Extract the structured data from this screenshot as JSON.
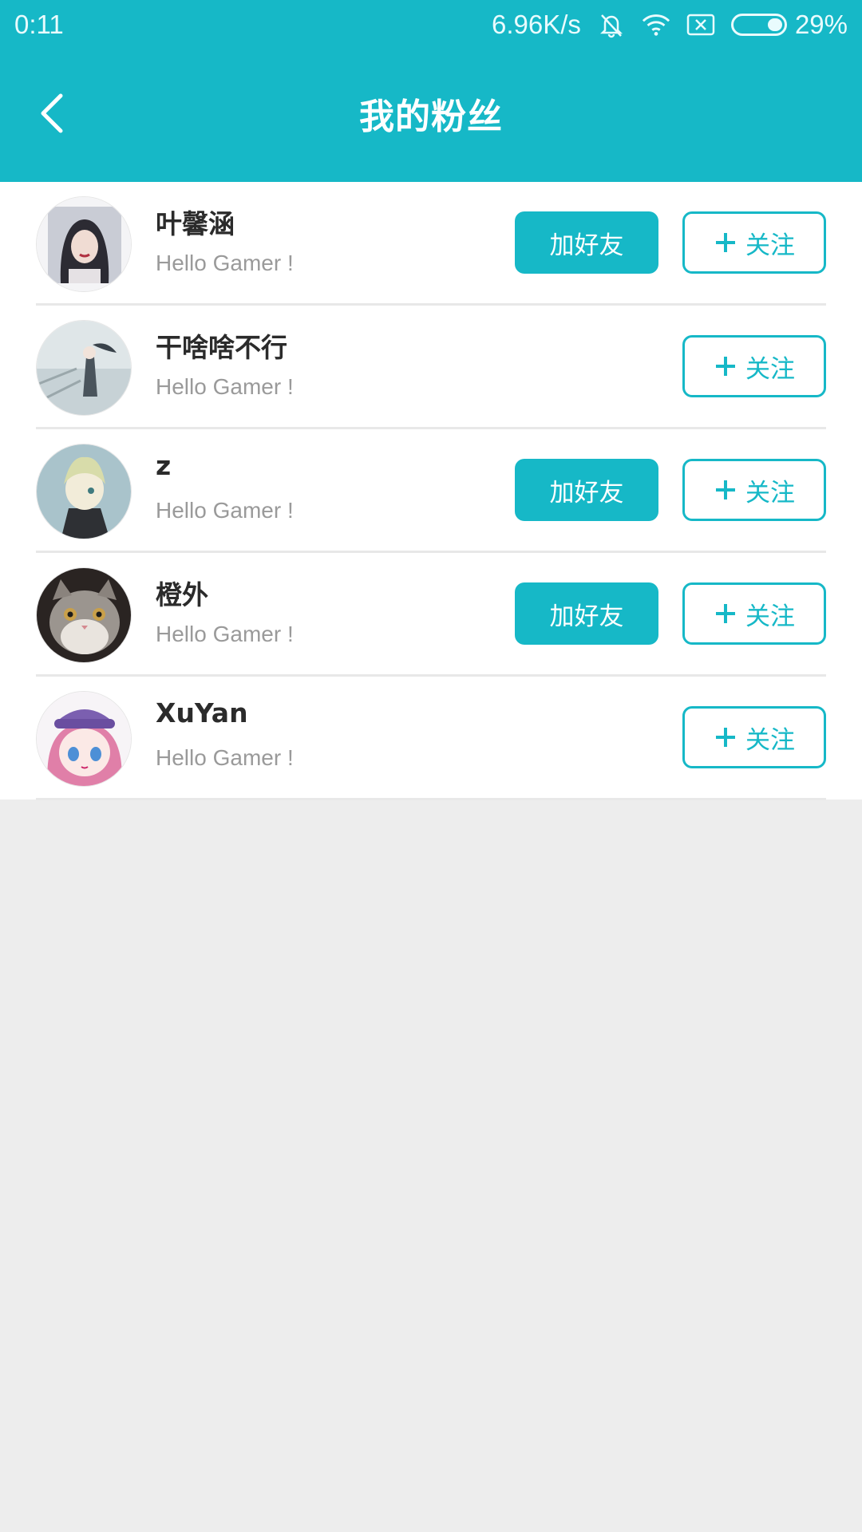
{
  "status_bar": {
    "time": "0:11",
    "network_speed": "6.96K/s",
    "battery_percent": "29%",
    "icons": [
      "bell-off-icon",
      "wifi-icon",
      "sim-off-icon",
      "battery-icon"
    ]
  },
  "header": {
    "title": "我的粉丝",
    "back_icon": "back-arrow-icon"
  },
  "colors": {
    "accent": "#16b8c7",
    "background": "#ededed",
    "name_text": "#2b2b2b",
    "bio_text": "#9a9a9a"
  },
  "fans": [
    {
      "name": "叶馨涵",
      "bio": "Hello Gamer !",
      "add_friend_label": "加好友",
      "follow_label": "关注",
      "has_add_friend": true
    },
    {
      "name": "干啥啥不行",
      "bio": "Hello Gamer !",
      "add_friend_label": "",
      "follow_label": "关注",
      "has_add_friend": false
    },
    {
      "name": "z",
      "bio": "Hello Gamer !",
      "add_friend_label": "加好友",
      "follow_label": "关注",
      "has_add_friend": true
    },
    {
      "name": "橙外",
      "bio": "Hello Gamer !",
      "add_friend_label": "加好友",
      "follow_label": "关注",
      "has_add_friend": true
    },
    {
      "name": "XuYan",
      "bio": "Hello Gamer !",
      "add_friend_label": "",
      "follow_label": "关注",
      "has_add_friend": false
    }
  ]
}
